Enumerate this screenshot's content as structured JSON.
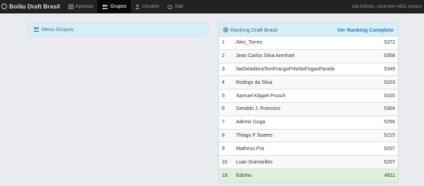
{
  "navbar": {
    "brand": "Bolão Draft Brasil",
    "items": [
      {
        "label": "Apostas",
        "icon": "table-icon",
        "active": false
      },
      {
        "label": "Grupos",
        "icon": "users-icon",
        "active": true
      },
      {
        "label": "Usuário",
        "icon": "user-icon",
        "active": false
      },
      {
        "label": "Sair",
        "icon": "power-icon",
        "active": false
      }
    ],
    "greeting": "Olá Edinho, você tem 4911 pontos"
  },
  "groups_panel": {
    "title": "Meus Grupos",
    "icon": "users-icon"
  },
  "ranking_panel": {
    "title": "Ranking Draft Brasil",
    "icon": "globe-icon",
    "link_label": "Ver Ranking Completo",
    "rows": [
      {
        "pos": "1",
        "name": "Alex_Torres",
        "points": "5372"
      },
      {
        "pos": "2",
        "name": "Jean Carlos Silva Arenhart",
        "points": "5358"
      },
      {
        "pos": "3",
        "name": "NaGeladeiraTemFrangoFritoNoFogaoPanela",
        "points": "5349"
      },
      {
        "pos": "4",
        "name": "Rodrigo da Silva",
        "points": "5323"
      },
      {
        "pos": "5",
        "name": "Samuel Klippel Prusch",
        "points": "5320"
      },
      {
        "pos": "6",
        "name": "Geraldo J. Franciosi",
        "points": "5304"
      },
      {
        "pos": "7",
        "name": "Ademir Guga",
        "points": "5266"
      },
      {
        "pos": "8",
        "name": "Thiago F Soares",
        "points": "5215"
      },
      {
        "pos": "9",
        "name": "Matheus Prá",
        "points": "5207"
      },
      {
        "pos": "10",
        "name": "Luan Guimarães",
        "points": "5207"
      },
      {
        "pos": "19",
        "name": "Edinho",
        "points": "4911",
        "highlight": true
      }
    ]
  },
  "colors": {
    "navbar": "#222222",
    "panel_heading": "#d9edf7",
    "panel_text": "#31708f",
    "highlight_row": "#dff0d8"
  }
}
